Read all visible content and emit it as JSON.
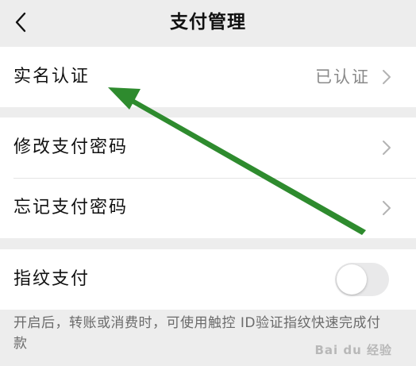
{
  "navbar": {
    "title": "支付管理",
    "back_icon": "chevron-left-icon"
  },
  "groups": [
    {
      "items": [
        {
          "label": "实名认证",
          "value": "已认证",
          "chevron": true
        }
      ]
    },
    {
      "items": [
        {
          "label": "修改支付密码",
          "chevron": true
        },
        {
          "label": "忘记支付密码",
          "chevron": true
        }
      ]
    },
    {
      "items": [
        {
          "label": "指纹支付",
          "toggle": false
        }
      ]
    }
  ],
  "footnote": "开启后，转账或消费时，可使用触控 ID验证指纹快速完成付款",
  "annotation": {
    "arrow_color": "#2e8b2e",
    "points_to": "实名认证"
  },
  "watermark": "Bai du 经验"
}
